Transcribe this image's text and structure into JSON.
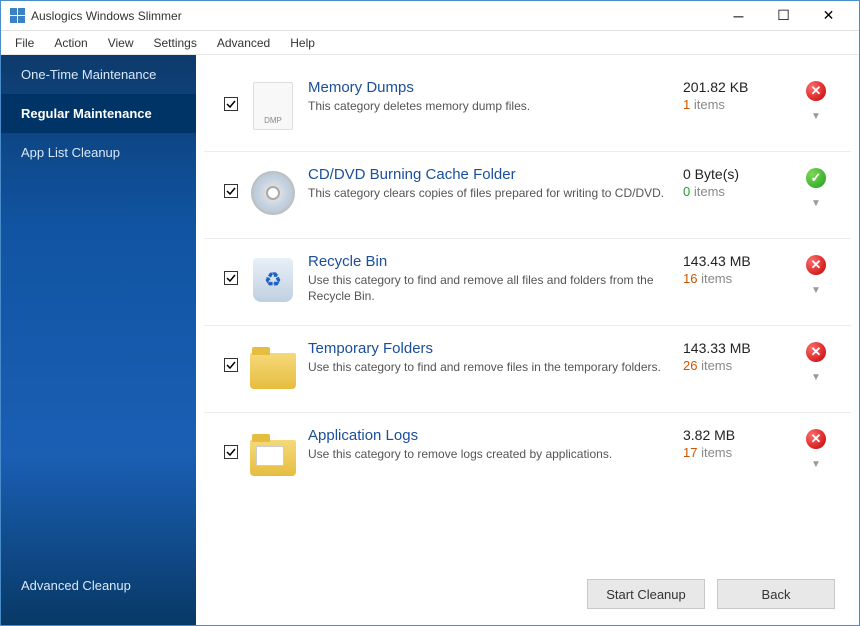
{
  "window": {
    "title": "Auslogics Windows Slimmer"
  },
  "menu": {
    "file": "File",
    "action": "Action",
    "view": "View",
    "settings": "Settings",
    "advanced": "Advanced",
    "help": "Help"
  },
  "sidebar": {
    "items": [
      {
        "label": "One-Time Maintenance"
      },
      {
        "label": "Regular Maintenance"
      },
      {
        "label": "App List Cleanup"
      }
    ],
    "advanced_cleanup": "Advanced Cleanup"
  },
  "categories": [
    {
      "title": "Memory Dumps",
      "desc": "This category deletes memory dump files.",
      "size": "201.82 KB",
      "count": "1",
      "count_zero": false,
      "items_label": " items",
      "status": "err",
      "icon": "file"
    },
    {
      "title": "CD/DVD Burning Cache Folder",
      "desc": "This category clears copies of files prepared for writing to CD/DVD.",
      "size": "0 Byte(s)",
      "count": "0",
      "count_zero": true,
      "items_label": " items",
      "status": "ok",
      "icon": "cd"
    },
    {
      "title": "Recycle Bin",
      "desc": "Use this category to find and remove all files and folders from the Recycle Bin.",
      "size": "143.43 MB",
      "count": "16",
      "count_zero": false,
      "items_label": " items",
      "status": "err",
      "icon": "bin"
    },
    {
      "title": "Temporary Folders",
      "desc": "Use this category to find and remove files in the temporary folders.",
      "size": "143.33 MB",
      "count": "26",
      "count_zero": false,
      "items_label": " items",
      "status": "err",
      "icon": "folder"
    },
    {
      "title": "Application Logs",
      "desc": "Use this category to remove logs created by applications.",
      "size": "3.82 MB",
      "count": "17",
      "count_zero": false,
      "items_label": " items",
      "status": "err",
      "icon": "folder2"
    }
  ],
  "footer": {
    "start_cleanup": "Start Cleanup",
    "back": "Back"
  }
}
